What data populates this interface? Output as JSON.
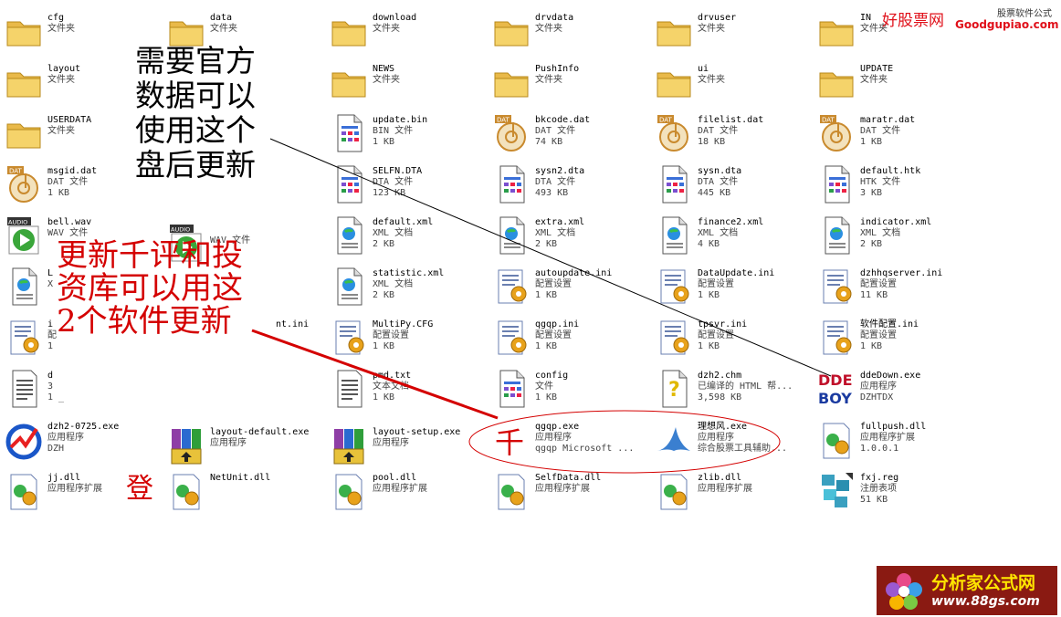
{
  "items": [
    {
      "id": "cfg",
      "icon": "folder",
      "name": "cfg",
      "line2": "文件夹",
      "line3": ""
    },
    {
      "id": "data",
      "icon": "folder",
      "name": "data",
      "line2": "文件夹",
      "line3": ""
    },
    {
      "id": "download",
      "icon": "folder",
      "name": "download",
      "line2": "文件夹",
      "line3": ""
    },
    {
      "id": "drvdata",
      "icon": "folder",
      "name": "drvdata",
      "line2": "文件夹",
      "line3": ""
    },
    {
      "id": "drvuser",
      "icon": "folder",
      "name": "drvuser",
      "line2": "文件夹",
      "line3": ""
    },
    {
      "id": "in",
      "icon": "folder",
      "name": "IN",
      "line2": "文件夹",
      "line3": ""
    },
    {
      "id": "layout",
      "icon": "folder",
      "name": "layout",
      "line2": "文件夹",
      "line3": ""
    },
    {
      "id": "news",
      "icon": "folder",
      "name": "NEWS",
      "line2": "文件夹",
      "line3": ""
    },
    {
      "id": "pushinfo",
      "icon": "folder",
      "name": "PushInfo",
      "line2": "文件夹",
      "line3": ""
    },
    {
      "id": "ui",
      "icon": "folder",
      "name": "ui",
      "line2": "文件夹",
      "line3": ""
    },
    {
      "id": "update",
      "icon": "folder",
      "name": "UPDATE",
      "line2": "文件夹",
      "line3": ""
    },
    {
      "id": "userdata",
      "icon": "folder",
      "name": "USERDATA",
      "line2": "文件夹",
      "line3": ""
    },
    {
      "id": "update-bin",
      "icon": "doc",
      "name": "update.bin",
      "line2": "BIN 文件",
      "line3": "1 KB"
    },
    {
      "id": "bkcode",
      "icon": "dat",
      "name": "bkcode.dat",
      "line2": "DAT 文件",
      "line3": "74 KB"
    },
    {
      "id": "filelist",
      "icon": "dat",
      "name": "filelist.dat",
      "line2": "DAT 文件",
      "line3": "18 KB"
    },
    {
      "id": "maratr",
      "icon": "dat",
      "name": "maratr.dat",
      "line2": "DAT 文件",
      "line3": "1 KB"
    },
    {
      "id": "msgid",
      "icon": "dat",
      "name": "msgid.dat",
      "line2": "DAT 文件",
      "line3": "1 KB"
    },
    {
      "id": "selfn",
      "icon": "doc",
      "name": "SELFN.DTA",
      "line2": "DTA 文件",
      "line3": "123 KB"
    },
    {
      "id": "sysn2",
      "icon": "doc",
      "name": "sysn2.dta",
      "line2": "DTA 文件",
      "line3": "493 KB"
    },
    {
      "id": "sysn",
      "icon": "doc",
      "name": "sysn.dta",
      "line2": "DTA 文件",
      "line3": "445 KB"
    },
    {
      "id": "default-htk",
      "icon": "doc",
      "name": "default.htk",
      "line2": "HTK 文件",
      "line3": "3 KB"
    },
    {
      "id": "bell",
      "icon": "audio",
      "name": "bell.wav",
      "line2": "WAV 文件",
      "line3": ""
    },
    {
      "id": "wav2",
      "icon": "audio",
      "name": "",
      "line2": "WAV 文件",
      "line3": ""
    },
    {
      "id": "default-xml",
      "icon": "xml",
      "name": "default.xml",
      "line2": "XML 文档",
      "line3": "2 KB"
    },
    {
      "id": "extra-xml",
      "icon": "xml",
      "name": "extra.xml",
      "line2": "XML 文档",
      "line3": "2 KB"
    },
    {
      "id": "finance2-xml",
      "icon": "xml",
      "name": "finance2.xml",
      "line2": "XML 文档",
      "line3": "4 KB"
    },
    {
      "id": "indicator-xml",
      "icon": "xml",
      "name": "indicator.xml",
      "line2": "XML 文档",
      "line3": "2 KB"
    },
    {
      "id": "l-xml",
      "icon": "xml",
      "name": "L",
      "line2": "X",
      "line3": ""
    },
    {
      "id": "statistic-xml",
      "icon": "xml",
      "name": "statistic.xml",
      "line2": "XML 文档",
      "line3": "2 KB"
    },
    {
      "id": "autoupdate",
      "icon": "ini",
      "name": "autoupdate.ini",
      "line2": "配置设置",
      "line3": "1 KB"
    },
    {
      "id": "dataupdate",
      "icon": "ini",
      "name": "DataUpdate.ini",
      "line2": "配置设置",
      "line3": "1 KB"
    },
    {
      "id": "dzhhqserver",
      "icon": "ini",
      "name": "dzhhqserver.ini",
      "line2": "配置设置",
      "line3": "11 KB"
    },
    {
      "id": "i-ini",
      "icon": "ini",
      "name": "i",
      "line2": "配",
      "line3": "1"
    },
    {
      "id": "nt-ini",
      "icon": "none",
      "name": "nt.ini",
      "line2": "",
      "line3": ""
    },
    {
      "id": "multipy",
      "icon": "ini",
      "name": "MultiPy.CFG",
      "line2": "配置设置",
      "line3": "1 KB"
    },
    {
      "id": "qgqp-ini",
      "icon": "ini",
      "name": "qgqp.ini",
      "line2": "配置设置",
      "line3": "1 KB"
    },
    {
      "id": "tpsvr",
      "icon": "ini",
      "name": "tpsvr.ini",
      "line2": "配置设置",
      "line3": "1 KB"
    },
    {
      "id": "soft-ini",
      "icon": "ini",
      "name": "软件配置.ini",
      "line2": "配置设置",
      "line3": "1 KB"
    },
    {
      "id": "d-txt",
      "icon": "txt",
      "name": "d",
      "line2": "3",
      "line3": "1 _"
    },
    {
      "id": "pmd",
      "icon": "txt",
      "name": "pmd.txt",
      "line2": "文本文档",
      "line3": "1 KB"
    },
    {
      "id": "config",
      "icon": "doc",
      "name": "config",
      "line2": "文件",
      "line3": "1 KB"
    },
    {
      "id": "dzh2-chm",
      "icon": "chm",
      "name": "dzh2.chm",
      "line2": "已编译的 HTML 帮...",
      "line3": "3,598 KB"
    },
    {
      "id": "ddedown",
      "icon": "ddeboy",
      "name": "ddeDown.exe",
      "line2": "应用程序",
      "line3": "DZHTDX"
    },
    {
      "id": "dzh2-exe",
      "icon": "dzh",
      "name": "dzh2-0725.exe",
      "line2": "应用程序",
      "line3": "DZH"
    },
    {
      "id": "layout-default",
      "icon": "winrar",
      "name": "layout-default.exe",
      "line2": "应用程序",
      "line3": ""
    },
    {
      "id": "layout-setup",
      "icon": "winrar",
      "name": "layout-setup.exe",
      "line2": "应用程序",
      "line3": ""
    },
    {
      "id": "qgqp-exe",
      "icon": "qian",
      "name": "qgqp.exe",
      "line2": "应用程序",
      "line3": "qgqp Microsoft ..."
    },
    {
      "id": "lxf-exe",
      "icon": "lxf",
      "name": "理想风.exe",
      "line2": "应用程序",
      "line3": "综合股票工具辅助..."
    },
    {
      "id": "fullpush",
      "icon": "dll",
      "name": "fullpush.dll",
      "line2": "应用程序扩展",
      "line3": "1.0.0.1"
    },
    {
      "id": "jj-dll",
      "icon": "dll",
      "name": "jj.dll",
      "line2": "应用程序扩展",
      "line3": ""
    },
    {
      "id": "netunit",
      "icon": "dll",
      "name": "NetUnit.dll",
      "line2": "",
      "line3": ""
    },
    {
      "id": "pool-dll",
      "icon": "dll",
      "name": "pool.dll",
      "line2": "应用程序扩展",
      "line3": ""
    },
    {
      "id": "selfdata",
      "icon": "dll",
      "name": "SelfData.dll",
      "line2": "应用程序扩展",
      "line3": ""
    },
    {
      "id": "zlib",
      "icon": "dll",
      "name": "zlib.dll",
      "line2": "应用程序扩展",
      "line3": ""
    },
    {
      "id": "fxj-reg",
      "icon": "reg",
      "name": "fxj.reg",
      "line2": "注册表项",
      "line3": "51 KB"
    }
  ],
  "annotations": {
    "a1": [
      "需要官方",
      "数据可以",
      "使用这个",
      "盘后更新"
    ],
    "a2": [
      "更新千评和投",
      "资库可以用这",
      "2个软件更新"
    ],
    "a3": [
      "登"
    ]
  },
  "watermarks": {
    "top_site": "好股票网",
    "top_tag": "股票软件公式",
    "top_url": "Goodgupiao.com",
    "bottom_title": "分析家公式网",
    "bottom_url": "www.88gs.com"
  },
  "colors": {
    "annotation_red": "#d40000",
    "folder": "#f5d36a",
    "ini_gear": "#e8a21b"
  }
}
